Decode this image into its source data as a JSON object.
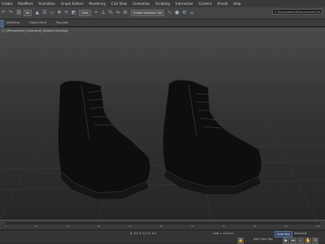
{
  "menu": {
    "items": [
      "Create",
      "Modifiers",
      "Animation",
      "Graph Editors",
      "Rendering",
      "Civil View",
      "Customize",
      "Scripting",
      "Interactive",
      "Content",
      "Arnold",
      "Help"
    ]
  },
  "toolbar": {
    "selection_filter": "All",
    "view_dropdown": "View",
    "named_selection": "Create Selection Set"
  },
  "search": {
    "value": "C:\\Users\\default\\Documents\\3ds Max 2023"
  },
  "ribbon": {
    "tabs": [
      "Modeling",
      "Object Paint",
      "Populate"
    ]
  },
  "viewport": {
    "label": "[+] [Perspective] [Standard] [Default Shading]"
  },
  "timeline": {
    "ticks": [
      "0",
      "10",
      "20",
      "30",
      "40",
      "50",
      "60",
      "70",
      "80",
      "90",
      "100"
    ]
  },
  "status": {
    "coords": "X: 0,0  Y: 0,0  Z: 0,0",
    "grid": "Grid = 10,0cm",
    "autokey": "Auto Key",
    "setkey": "Set Key",
    "add_time_tag": "Add Time Tag",
    "selected": "Selected"
  },
  "colors": {
    "accent": "#56698f",
    "background": "#2b2b2b"
  }
}
